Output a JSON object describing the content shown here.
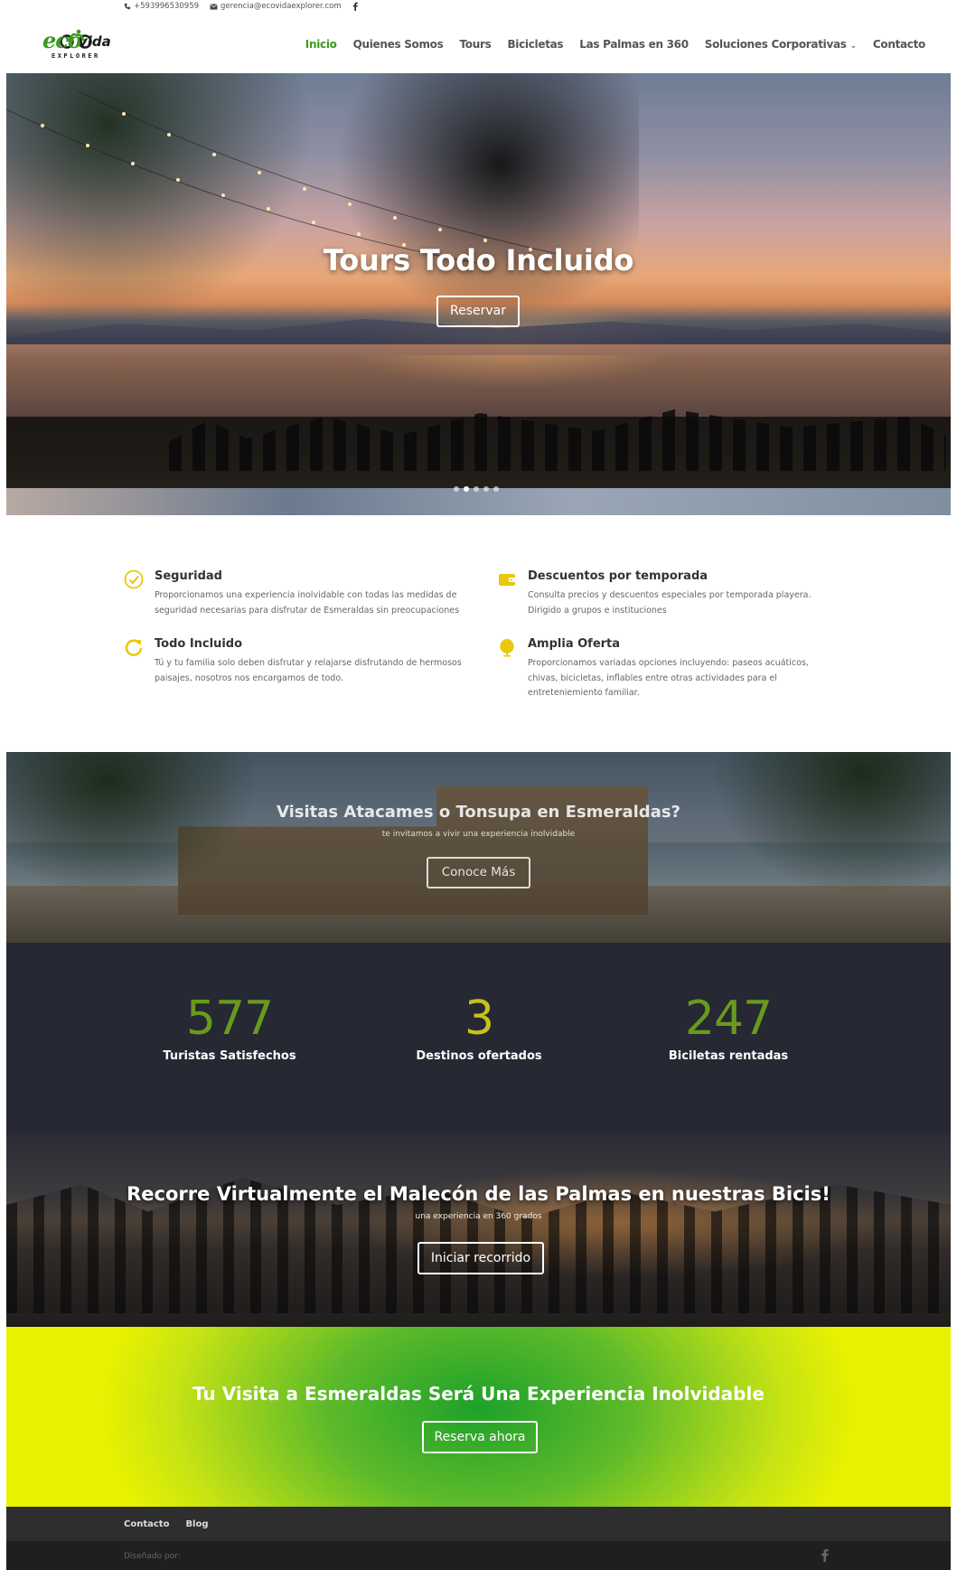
{
  "topbar": {
    "phone": "+593996530959",
    "email": "gerencia@ecovidaexplorer.com",
    "phone_icon": "phone-icon",
    "email_icon": "envelope-icon",
    "social_icon": "facebook-icon"
  },
  "logo": {
    "eco": "eco",
    "vida": "vida",
    "sub": "EXPLORER"
  },
  "nav": {
    "items": [
      {
        "label": "Inicio",
        "active": true
      },
      {
        "label": "Quienes Somos"
      },
      {
        "label": "Tours"
      },
      {
        "label": "Bicicletas"
      },
      {
        "label": "Las Palmas en 360"
      },
      {
        "label": "Soluciones Corporativas",
        "dropdown": true
      },
      {
        "label": "Contacto"
      }
    ],
    "active_color": "#3c9c1f"
  },
  "hero": {
    "title": "Tours Todo Incluido",
    "button": "Reservar",
    "slides": 5,
    "active_slide": 2
  },
  "features": [
    {
      "icon": "check-circle-icon",
      "title": "Seguridad",
      "text": "Proporcionamos una experiencia inolvidable con todas las medidas de seguridad necesarias para disfrutar de Esmeraldas sin preocupaciones"
    },
    {
      "icon": "wallet-icon",
      "title": "Descuentos por temporada",
      "text": "Consulta precios y descuentos especiales por temporada playera. Dirigido a grupos e instituciones"
    },
    {
      "icon": "refresh-icon",
      "title": "Todo Incluido",
      "text": "Tú y tu familia solo deben disfrutar y relajarse disfrutando de hermosos paisajes, nosotros nos encargamos de todo."
    },
    {
      "icon": "globe-icon",
      "title": "Amplia Oferta",
      "text": "Proporcionamos variadas opciones incluyendo: paseos acuáticos, chivas, bicicletas, inflables entre otras actividades para el entreteniemiento familiar."
    }
  ],
  "feature_icon_color": "#e8c90c",
  "promo": {
    "title": "Visitas Atacames o Tonsupa en Esmeraldas?",
    "subtitle": "te invitamos a vivir una experiencia inolvidable",
    "button": "Conoce Más"
  },
  "stats": [
    {
      "value": "577",
      "label": "Turistas Satisfechos",
      "color": "#6a9a1c"
    },
    {
      "value": "3",
      "label": "Destinos ofertados",
      "color": "#c7c21a"
    },
    {
      "value": "247",
      "label": "Biciletas rentadas",
      "color": "#6a9a1c"
    }
  ],
  "virtual": {
    "title": "Recorre Virtualmente el Malecón de las Palmas en nuestras Bicis!",
    "subtitle": "una experiencia en 360 grados",
    "button": "Iniciar recorrido"
  },
  "cta": {
    "title": "Tu Visita a Esmeraldas Será Una Experiencia Inolvidable",
    "button": "Reserva ahora"
  },
  "footer": {
    "links": [
      "Contacto",
      "Blog"
    ],
    "credit": "Diseñado por:",
    "social_icon": "facebook-icon"
  }
}
